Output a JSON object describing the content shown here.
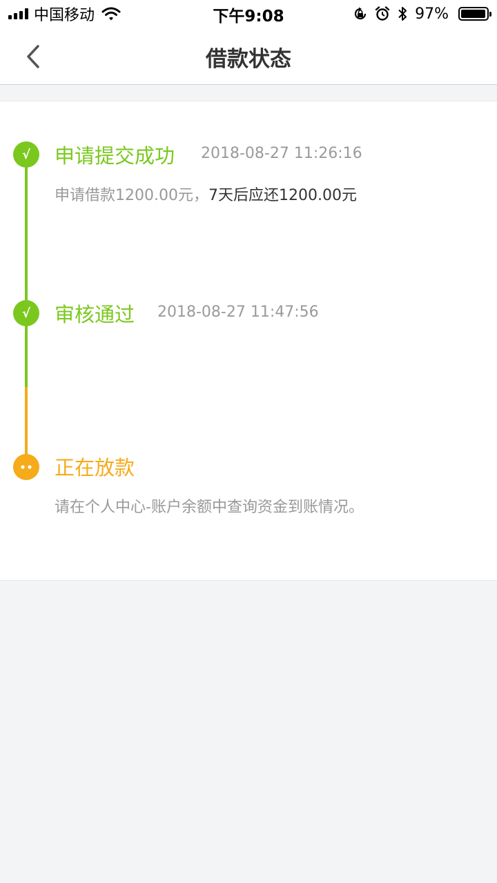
{
  "status_bar": {
    "carrier": "中国移动",
    "time": "下午9:08",
    "battery": "97%",
    "battery_level": 0.97,
    "icons": [
      "signal-icon",
      "wifi-icon",
      "orientation-lock-icon",
      "alarm-icon",
      "bluetooth-icon",
      "battery-icon"
    ]
  },
  "nav": {
    "title": "借款状态",
    "back_icon": "chevron-left-icon"
  },
  "steps": [
    {
      "status": "done",
      "icon": "check-icon",
      "title": "申请提交成功",
      "time": "2018-08-27 11:26:16",
      "desc_part1": "申请借款1200.00元，",
      "desc_part2": "7天后应还1200.00元"
    },
    {
      "status": "done",
      "icon": "check-icon",
      "title": "审核通过",
      "time": "2018-08-27 11:47:56"
    },
    {
      "status": "in-progress",
      "icon": "ellipsis-icon",
      "title": "正在放款",
      "desc": "请在个人中心-账户余额中查询资金到账情况。"
    }
  ],
  "colors": {
    "done": "#7ac81e",
    "pending": "#f5ab1a",
    "background": "#f3f4f6"
  }
}
